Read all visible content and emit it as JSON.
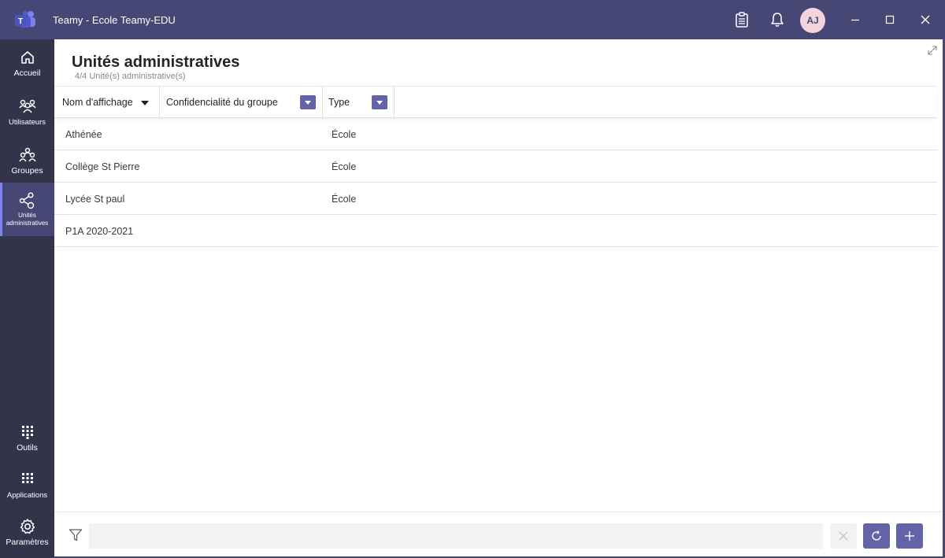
{
  "window": {
    "title": "Teamy - Ecole Teamy-EDU",
    "user_initials": "AJ"
  },
  "icons": {
    "app_logo": "teams-logo-icon",
    "clipboard": "clipboard-icon",
    "bell": "bell-icon",
    "minimize": "minimize-icon",
    "maximize": "maximize-icon",
    "close": "close-icon"
  },
  "colors": {
    "titlebar": "#464775",
    "rail": "#33344a",
    "accent": "#6264a7"
  },
  "rail": {
    "items": [
      {
        "label": "Accueil",
        "icon": "home-icon"
      },
      {
        "label": "Utilisateurs",
        "icon": "users-icon"
      },
      {
        "label": "Groupes",
        "icon": "groups-icon"
      },
      {
        "label": "Unités administratives",
        "icon": "admin-units-icon",
        "active": true
      },
      {
        "label": "Outils",
        "icon": "grid-icon"
      },
      {
        "label": "Applications",
        "icon": "apps-grid-icon"
      },
      {
        "label": "Paramètres",
        "icon": "gear-icon"
      }
    ]
  },
  "page": {
    "title": "Unités administratives",
    "subtitle": "4/4 Unité(s) administrative(s)"
  },
  "table": {
    "columns": [
      "Nom d'affichage",
      "Confidencialité du groupe",
      "Type"
    ],
    "rows": [
      {
        "name": "Athénée",
        "privacy": "",
        "type": "École"
      },
      {
        "name": "Collège St Pierre",
        "privacy": "",
        "type": "École"
      },
      {
        "name": "Lycée St paul",
        "privacy": "",
        "type": "École"
      },
      {
        "name": "P1A 2020-2021",
        "privacy": "",
        "type": ""
      }
    ]
  },
  "filter": {
    "value": "",
    "placeholder": ""
  }
}
